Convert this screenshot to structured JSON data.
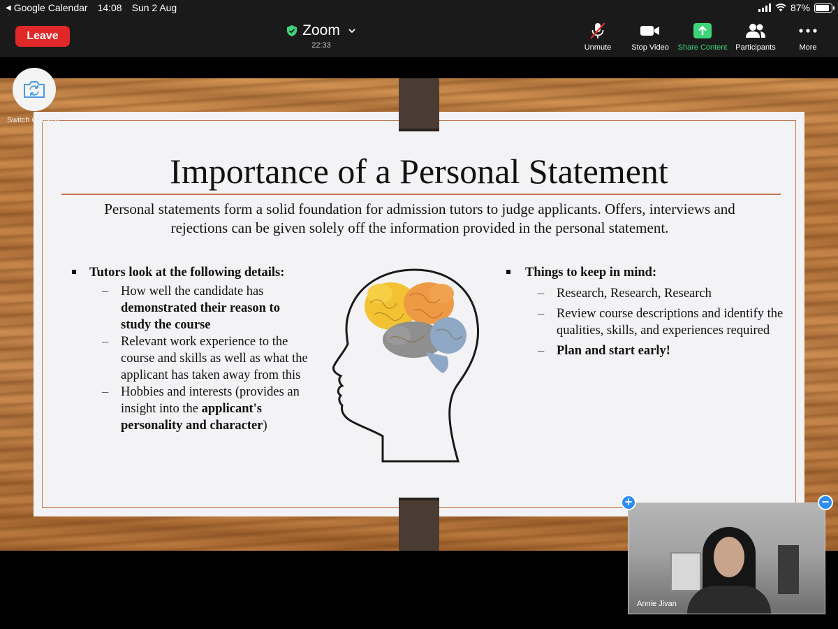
{
  "status_bar": {
    "back_app": "Google Calendar",
    "time": "14:08",
    "date": "Sun 2 Aug",
    "battery": "87%",
    "battery_level": 0.87
  },
  "toolbar": {
    "leave_label": "Leave",
    "meeting_title": "Zoom",
    "timer": "22:33",
    "buttons": [
      {
        "label": "Unmute",
        "icon": "mic-muted-icon"
      },
      {
        "label": "Stop Video",
        "icon": "video-camera-icon"
      },
      {
        "label": "Share Content",
        "icon": "share-arrow-icon"
      },
      {
        "label": "Participants",
        "icon": "participants-icon"
      },
      {
        "label": "More",
        "icon": "more-dots-icon"
      }
    ],
    "colors": {
      "leave": "#e02828",
      "share": "#3ed47a",
      "secure": "#3ed47a"
    }
  },
  "switch_camera": {
    "label": "Switch Camera"
  },
  "slide": {
    "title": "Importance of a Personal Statement",
    "intro": "Personal statements form a solid foundation for admission tutors to judge applicants. Offers, interviews and rejections can be given solely off the information provided in the personal statement.",
    "left": {
      "heading": "Tutors look at the following details:",
      "items": [
        {
          "pre": "How well the candidate has ",
          "bold": "demonstrated their reason to study the course",
          "post": ""
        },
        {
          "pre": "Relevant work experience to the course and skills as well as what the applicant has taken away from this",
          "bold": "",
          "post": ""
        },
        {
          "pre": "Hobbies and interests (provides an insight into the ",
          "bold": "applicant's personality and character",
          "post": ")"
        }
      ]
    },
    "right": {
      "heading": "Things to keep in mind:",
      "items": [
        {
          "pre": "Research, Research, Research",
          "bold": "",
          "post": ""
        },
        {
          "pre": "Review course descriptions and identify the qualities, skills, and experiences required",
          "bold": "",
          "post": ""
        },
        {
          "pre": "",
          "bold": "Plan and start early!",
          "post": ""
        }
      ]
    },
    "accent": "#c0784f"
  },
  "self_view": {
    "name": "Annie Jivan"
  }
}
